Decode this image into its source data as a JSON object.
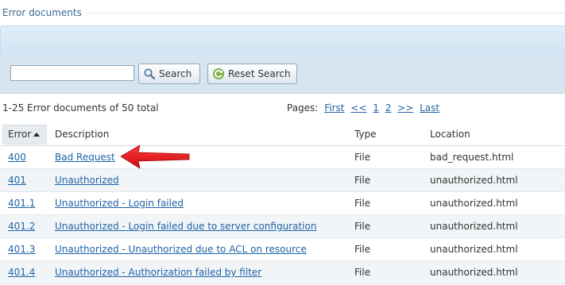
{
  "section": {
    "title": "Error documents"
  },
  "search": {
    "value": "",
    "placeholder": "",
    "search_label": "Search",
    "reset_label": "Reset Search"
  },
  "pager": {
    "summary": "1-25 Error documents of 50 total",
    "pages_label": "Pages:",
    "first": "First",
    "prev": "<<",
    "page1": "1",
    "page2": "2",
    "next": ">>",
    "last": "Last"
  },
  "table": {
    "headers": {
      "error": "Error",
      "description": "Description",
      "type": "Type",
      "location": "Location"
    },
    "rows": [
      {
        "error": "400",
        "description": "Bad Request",
        "type": "File",
        "location": "bad_request.html"
      },
      {
        "error": "401",
        "description": "Unauthorized",
        "type": "File",
        "location": "unauthorized.html"
      },
      {
        "error": "401.1",
        "description": "Unauthorized - Login failed",
        "type": "File",
        "location": "unauthorized.html"
      },
      {
        "error": "401.2",
        "description": "Unauthorized - Login failed due to server configuration",
        "type": "File",
        "location": "unauthorized.html"
      },
      {
        "error": "401.3",
        "description": "Unauthorized - Unauthorized due to ACL on resource",
        "type": "File",
        "location": "unauthorized.html"
      },
      {
        "error": "401.4",
        "description": "Unauthorized - Authorization failed by filter",
        "type": "File",
        "location": "unauthorized.html"
      }
    ]
  },
  "icons": {
    "search": "magnifier-icon",
    "reset": "refresh-icon",
    "sort": "sort-ascending-icon",
    "annotation": "red-arrow-icon"
  },
  "colors": {
    "link": "#1f63a8",
    "title": "#3c6a93",
    "band": "#d7e5ef",
    "annotation": "#e8141c"
  }
}
